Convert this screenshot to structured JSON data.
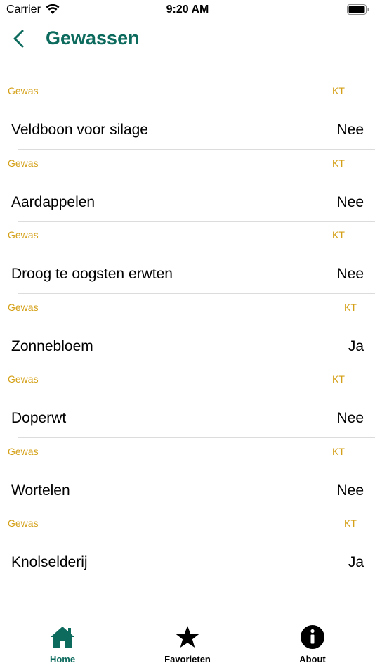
{
  "status_bar": {
    "carrier": "Carrier",
    "time": "9:20 AM"
  },
  "nav": {
    "title": "Gewassen"
  },
  "list": {
    "sections": [
      {
        "header_left": "Gewas",
        "header_right": "KT",
        "name": "Veldboon voor silage",
        "value": "Nee"
      },
      {
        "header_left": "Gewas",
        "header_right": "KT",
        "name": "Aardappelen",
        "value": "Nee"
      },
      {
        "header_left": "Gewas",
        "header_right": "KT",
        "name": "Droog te oogsten erwten",
        "value": "Nee"
      },
      {
        "header_left": "Gewas",
        "header_right": "KT",
        "name": "Zonnebloem",
        "value": "Ja"
      },
      {
        "header_left": "Gewas",
        "header_right": "KT",
        "name": "Doperwt",
        "value": "Nee"
      },
      {
        "header_left": "Gewas",
        "header_right": "KT",
        "name": "Wortelen",
        "value": "Nee"
      },
      {
        "header_left": "Gewas",
        "header_right": "KT",
        "name": "Knolselderij",
        "value": "Ja"
      }
    ]
  },
  "tabs": {
    "home": {
      "label": "Home",
      "icon": "house-icon"
    },
    "favorites": {
      "label": "Favorieten",
      "icon": "star-icon"
    },
    "about": {
      "label": "About",
      "icon": "info-icon"
    }
  },
  "colors": {
    "accent": "#0d6b5e",
    "header_text": "#d4a017"
  }
}
